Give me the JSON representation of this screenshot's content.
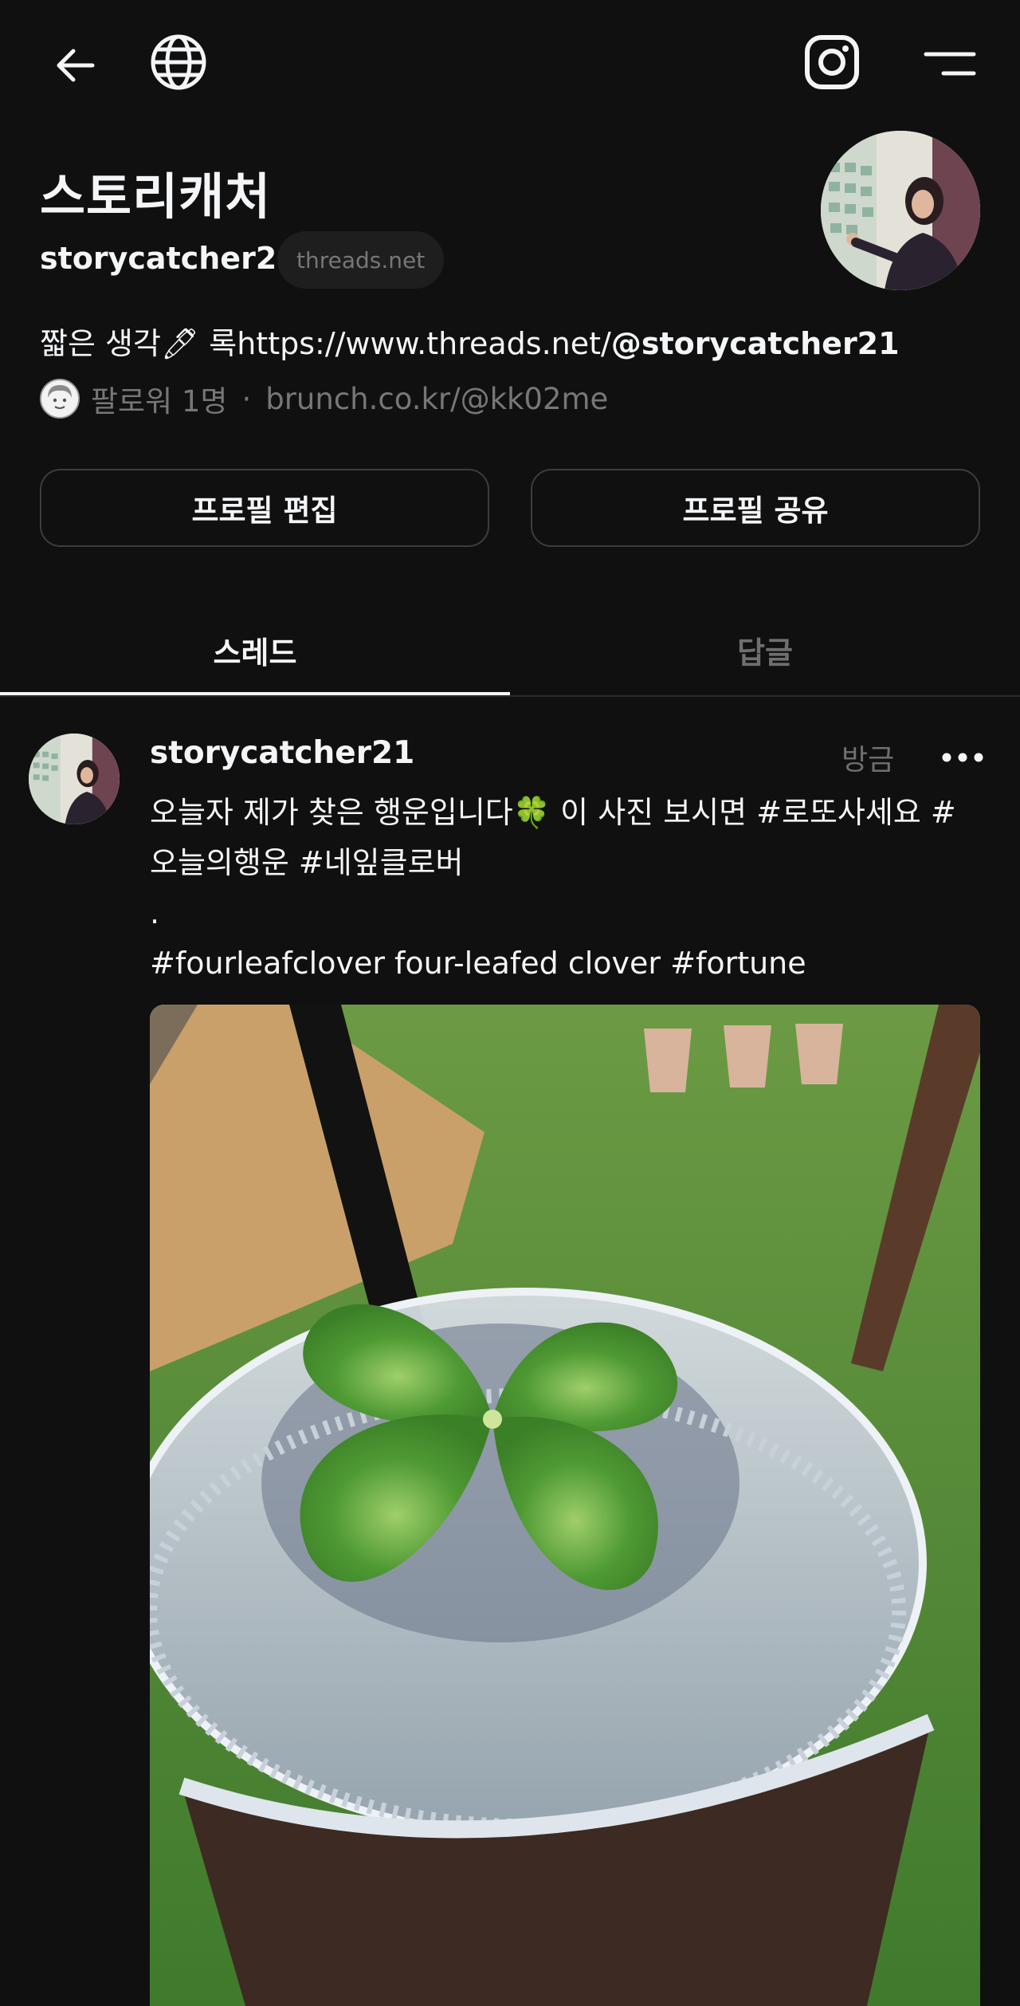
{
  "topbar": {
    "back_icon": "arrow-left-icon",
    "globe_icon": "globe-icon",
    "instagram_icon": "instagram-icon",
    "menu_icon": "menu-icon"
  },
  "profile": {
    "display_name": "스토리캐처",
    "handle": "storycatcher21",
    "domain_badge": "threads.net",
    "bio_prefix": "짧은 생각",
    "bio_emoji": "🖊",
    "bio_mid": " 록https://www.threads.net/",
    "bio_handle": "@storycatcher21",
    "followers": "팔로워 1명",
    "separator": "·",
    "link": "brunch.co.kr/@kk02me"
  },
  "actions": {
    "edit_label": "프로필 편집",
    "share_label": "프로필 공유"
  },
  "tabs": [
    {
      "label": "스레드",
      "active": true
    },
    {
      "label": "답글",
      "active": false
    }
  ],
  "post": {
    "author": "storycatcher21",
    "time": "방금",
    "more_icon": "more-horizontal-icon",
    "line1": "오늘자 제가 찾은 행운입니다🍀 이 사진 보시면 #로또사세요 #",
    "line2": "오늘의행운 #네잎클로버",
    "line3": ".",
    "line4": "#fourleafclover four-leafed clover #fortune"
  },
  "colors": {
    "background": "#101010",
    "text": "#f3f5f7",
    "muted": "#6f6f6f",
    "border": "#3d3d3d"
  }
}
